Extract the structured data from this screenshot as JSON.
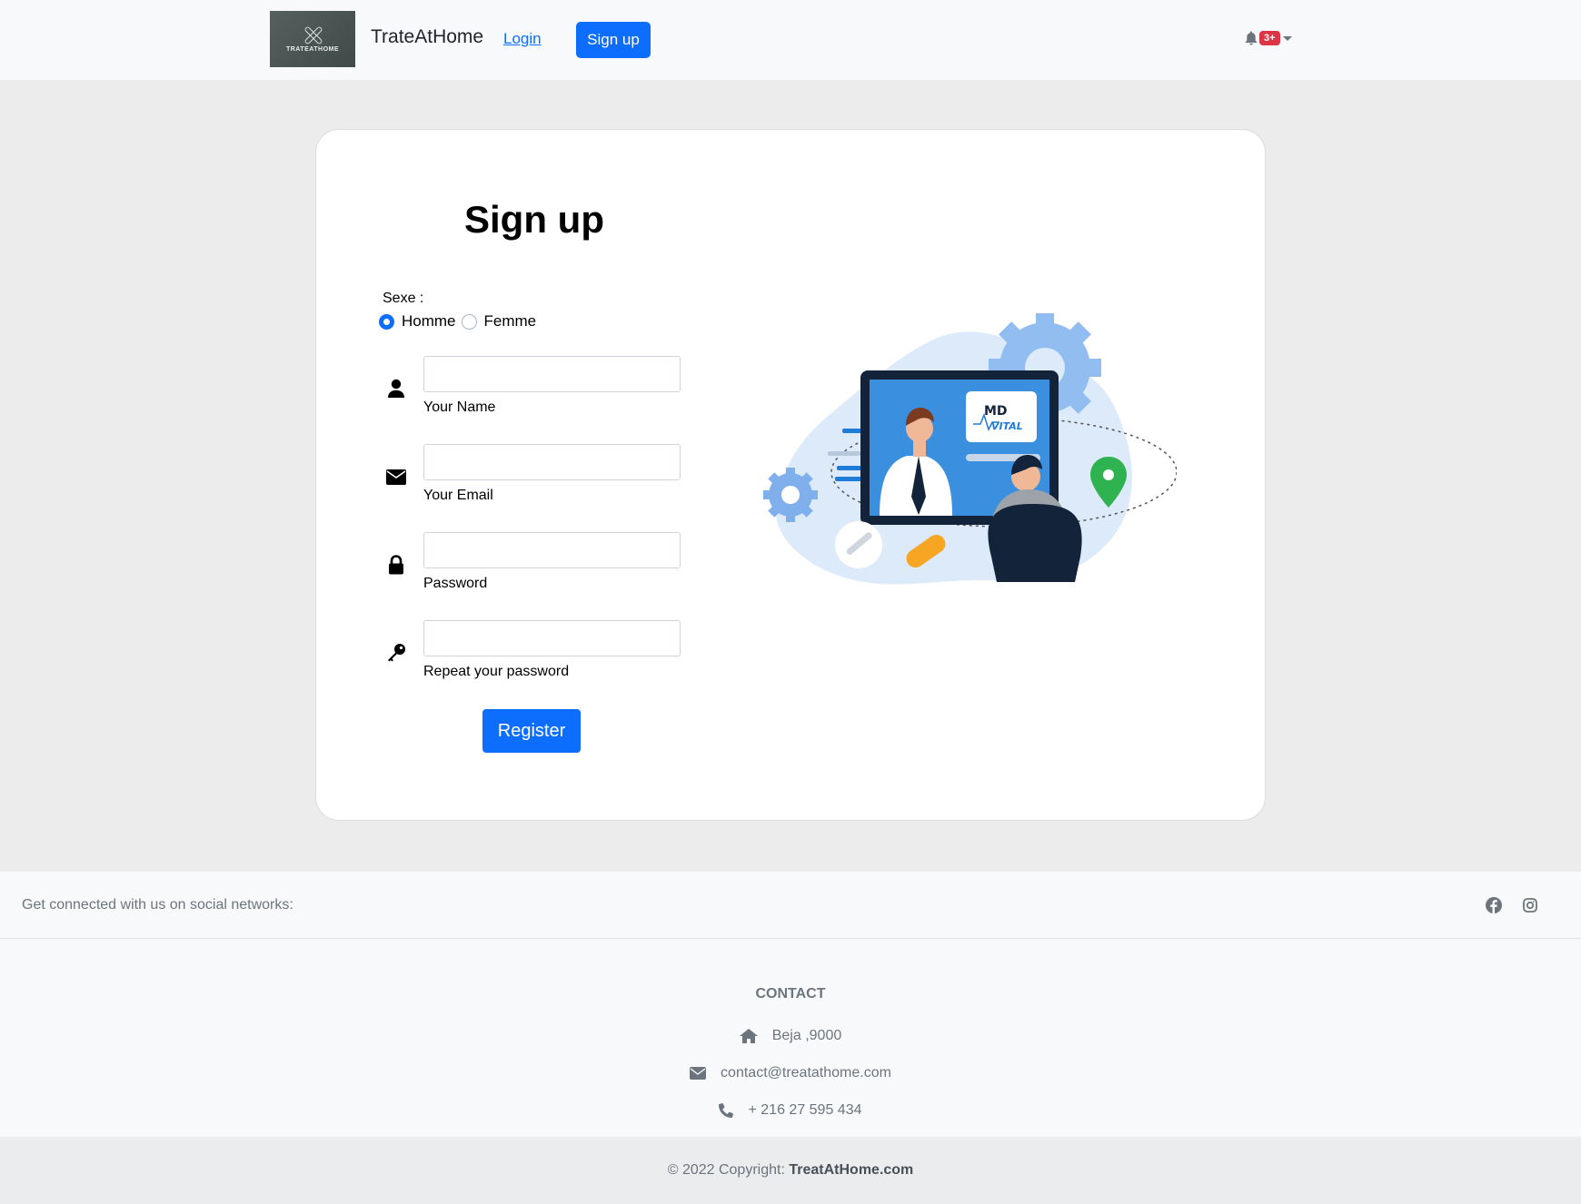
{
  "navbar": {
    "logo_text": "TRATEATHOME",
    "brand": "TrateAtHome",
    "login": "Login",
    "signup": "Sign up",
    "notification_badge": "3+"
  },
  "form": {
    "title": "Sign up",
    "sexe_label": "Sexe :",
    "options": [
      {
        "label": "Homme",
        "checked": true
      },
      {
        "label": "Femme",
        "checked": false
      }
    ],
    "fields": {
      "name": {
        "label": "Your Name",
        "icon": "user-icon",
        "value": ""
      },
      "email": {
        "label": "Your Email",
        "icon": "envelope-icon",
        "value": ""
      },
      "password": {
        "label": "Password",
        "icon": "lock-icon",
        "value": ""
      },
      "repeat": {
        "label": "Repeat your password",
        "icon": "key-icon",
        "value": ""
      }
    },
    "register": "Register"
  },
  "illustration": {
    "badge_line1": "MD",
    "badge_line2": "VITAL"
  },
  "footer": {
    "social_text": "Get connected with us on social networks:",
    "social_icons": [
      "facebook-icon",
      "instagram-icon"
    ],
    "contact_title": "CONTACT",
    "address": "Beja ,9000",
    "email": "contact@treatathome.com",
    "phone": "+ 216 27 595 434",
    "copyright_prefix": "© 2022 Copyright:",
    "copyright_site": "TreatAtHome.com"
  },
  "colors": {
    "primary": "#0d6efd",
    "badge": "#dc3545",
    "page_bg": "#ececec",
    "footer_bg": "#f8f9fa"
  }
}
